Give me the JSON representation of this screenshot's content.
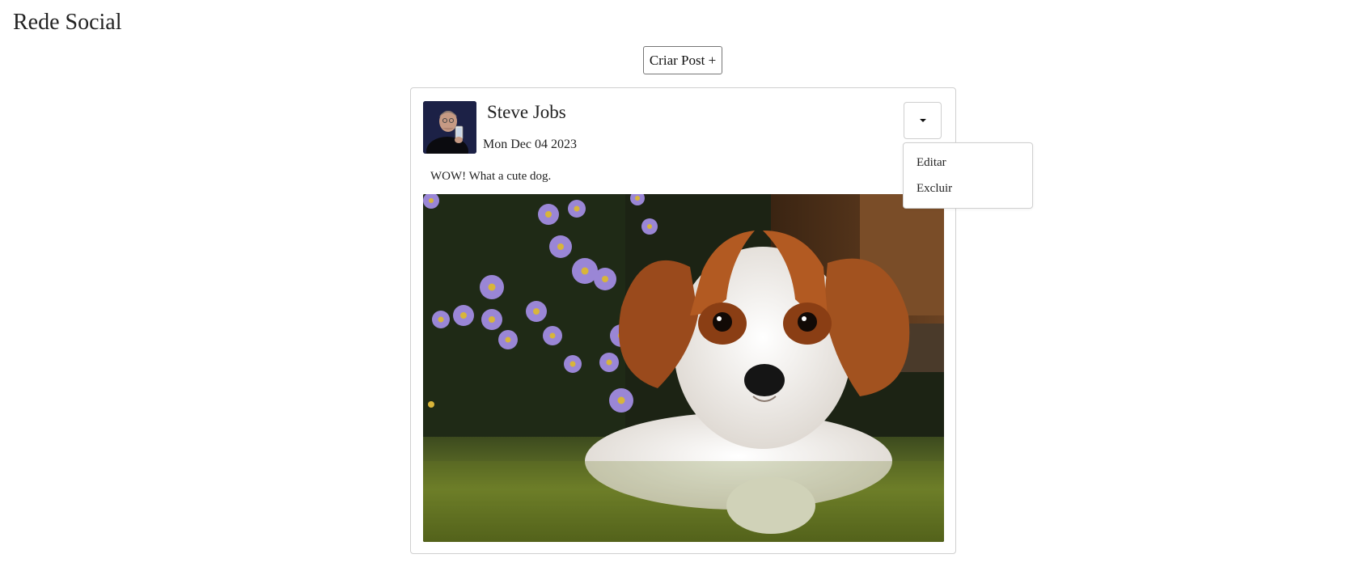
{
  "app": {
    "title": "Rede Social"
  },
  "toolbar": {
    "create_post_label": "Criar Post +"
  },
  "post": {
    "author": "Steve Jobs",
    "date": "Mon Dec 04 2023",
    "text": "WOW! What a cute dog.",
    "avatar_icon": "user-photo-icon",
    "image_icon": "dog-photo-icon"
  },
  "post_menu": {
    "toggle_icon": "caret-down-icon",
    "items": [
      {
        "label": "Editar"
      },
      {
        "label": "Excluir"
      }
    ]
  }
}
